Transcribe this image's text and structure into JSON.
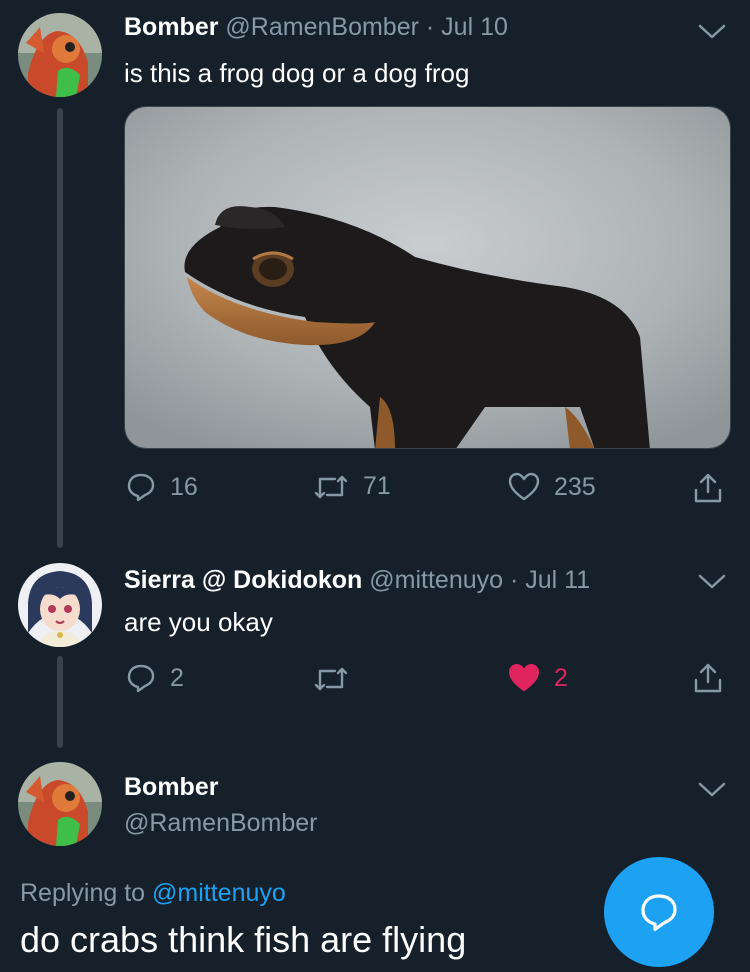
{
  "tweets": [
    {
      "name": "Bomber",
      "handle": "@RamenBomber",
      "separator": "·",
      "date": "Jul 10",
      "text": "is this a frog dog or a dog frog",
      "replies": "16",
      "retweets": "71",
      "likes": "235"
    },
    {
      "name": "Sierra @ Dokidokon",
      "handle": "@mittenuyo",
      "separator": "·",
      "date": "Jul 11",
      "text": "are you okay",
      "replies": "2",
      "retweets": "",
      "likes": "2"
    }
  ],
  "focused_tweet": {
    "name": "Bomber",
    "handle": "@RamenBomber",
    "replying_prefix": "Replying to",
    "replying_handle": "@mittenuyo",
    "text": "do crabs think fish are flying"
  },
  "icons": {
    "reply": "reply-icon",
    "retweet": "retweet-icon",
    "like": "heart-icon",
    "share": "share-icon",
    "caret": "chevron-down-icon",
    "compose": "compose-reply-icon"
  },
  "colors": {
    "background": "#15202b",
    "muted_text": "#8899a6",
    "liked": "#e0245e",
    "accent": "#1da1f2",
    "thread_line": "#38444d"
  }
}
